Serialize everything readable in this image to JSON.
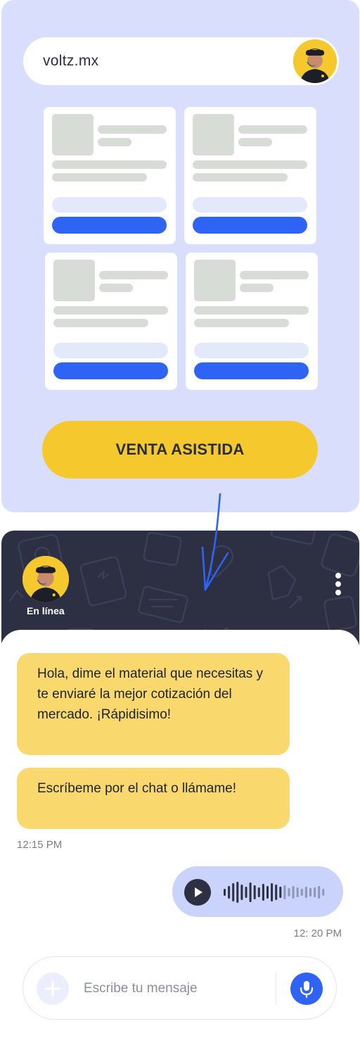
{
  "browser": {
    "url": "voltz.mx",
    "avatar_icon": "agent-avatar",
    "cta_label": "VENTA ASISTIDA",
    "product_card_count": 4
  },
  "chat": {
    "status": "En línea",
    "menu_icon": "kebab-menu-icon",
    "messages": [
      {
        "text": "Hola, dime el material que necesitas y te enviaré la mejor cotización del mercado. ¡Rápidisimo!"
      },
      {
        "text": "Escríbeme por el chat o llámame!"
      }
    ],
    "received_time": "12:15 PM",
    "audio_message": {
      "progress": 0.55
    },
    "sent_time": "12: 20 PM",
    "input": {
      "placeholder": "Escribe tu mensaje",
      "value": ""
    }
  },
  "colors": {
    "panel_bg": "#d8defb",
    "accent_yellow": "#f5c92e",
    "bubble_yellow": "#f9d96d",
    "primary_blue": "#2f63f3",
    "header_dark": "#2c3042"
  }
}
